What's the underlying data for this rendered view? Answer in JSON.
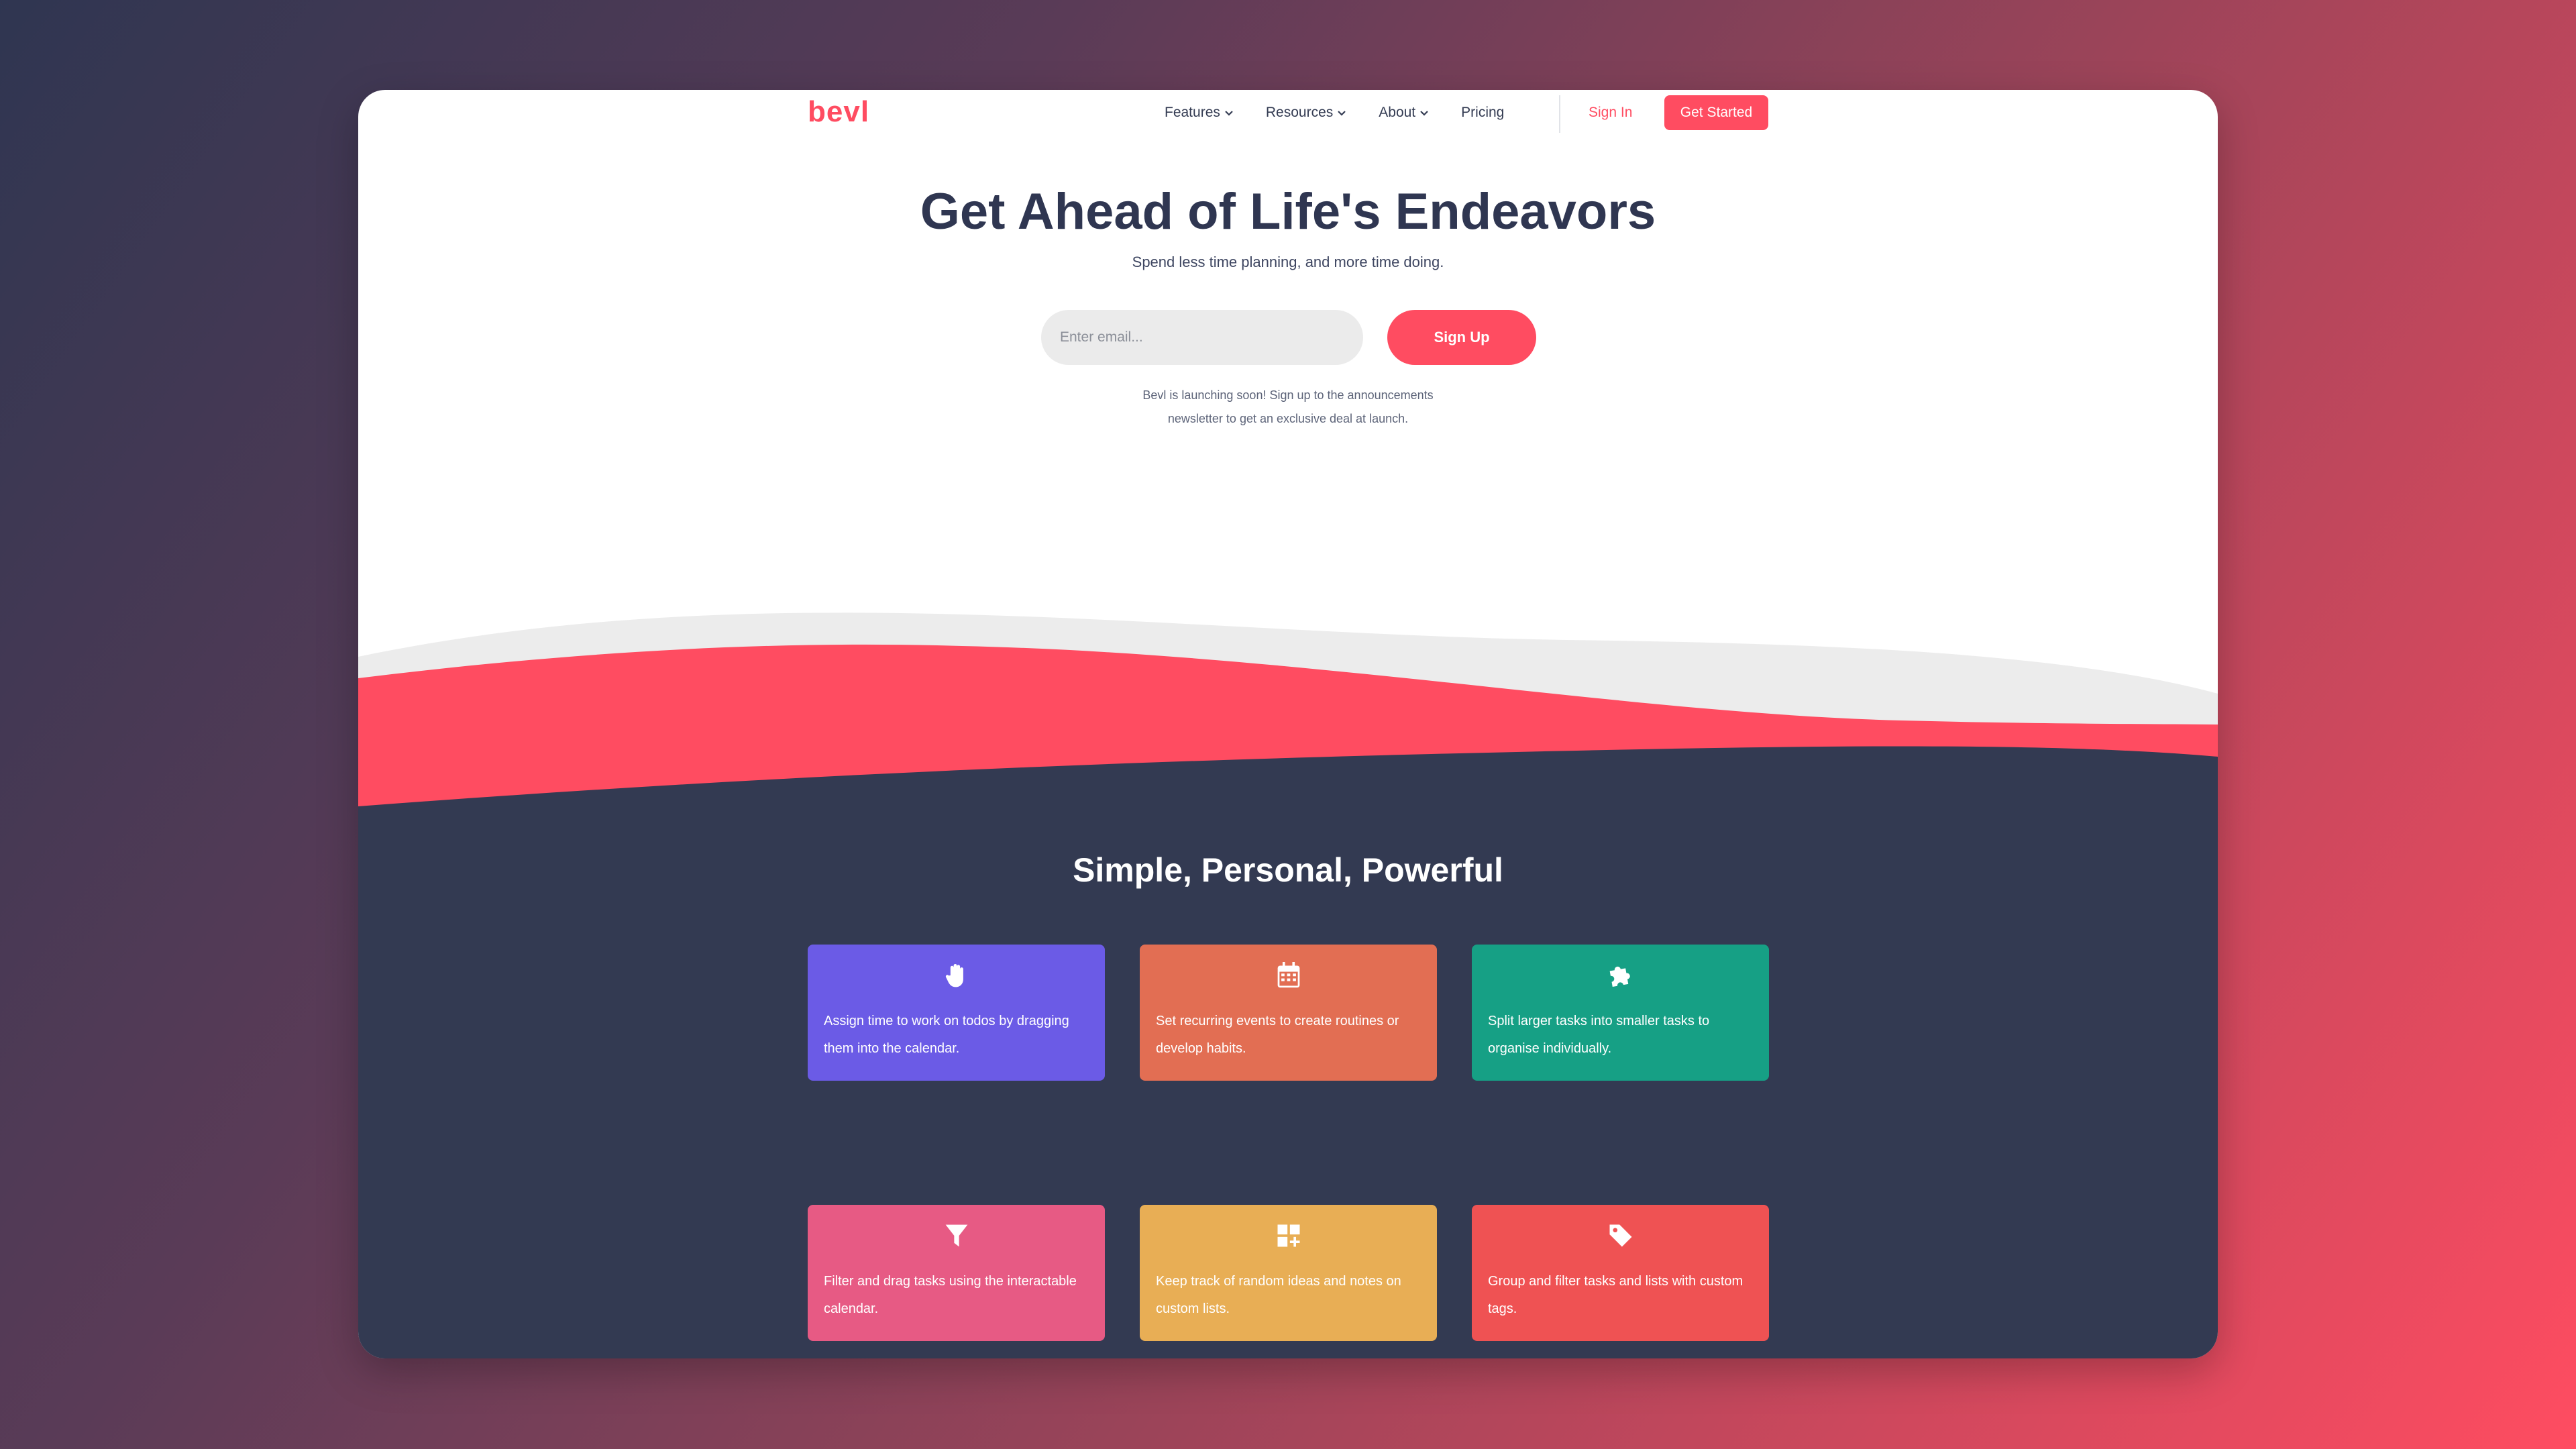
{
  "brand": {
    "logo": "bevl",
    "accent": "#ff4c61",
    "dark": "#333a52"
  },
  "nav": {
    "items": [
      {
        "label": "Features",
        "has_dropdown": true
      },
      {
        "label": "Resources",
        "has_dropdown": true
      },
      {
        "label": "About",
        "has_dropdown": true
      },
      {
        "label": "Pricing",
        "has_dropdown": false
      }
    ],
    "signin": "Sign In",
    "get_started": "Get Started"
  },
  "hero": {
    "title": "Get Ahead of Life's Endeavors",
    "subtitle": "Spend less time planning, and more time doing.",
    "email_placeholder": "Enter email...",
    "signup": "Sign Up",
    "note_line1": "Bevl is launching soon! Sign up to the announcements",
    "note_line2": "newsletter to get an exclusive deal at launch."
  },
  "features": {
    "title": "Simple, Personal, Powerful",
    "cards": [
      {
        "icon": "hand-icon",
        "color": "#6b5be6",
        "text": "Assign time to work on todos by dragging them into the calendar."
      },
      {
        "icon": "calendar-icon",
        "color": "#e26e53",
        "text": "Set recurring events to create routines or develop habits."
      },
      {
        "icon": "puzzle-icon",
        "color": "#16a085",
        "text": "Split larger tasks into smaller tasks to organise individually."
      },
      {
        "icon": "filter-icon",
        "color": "#e75a84",
        "text": "Filter and drag tasks using the interactable calendar."
      },
      {
        "icon": "grid-plus-icon",
        "color": "#e8ae55",
        "text": "Keep track of random ideas and notes on custom lists."
      },
      {
        "icon": "tag-icon",
        "color": "#ef5253",
        "text": "Group and filter tasks and lists with custom tags."
      }
    ]
  }
}
